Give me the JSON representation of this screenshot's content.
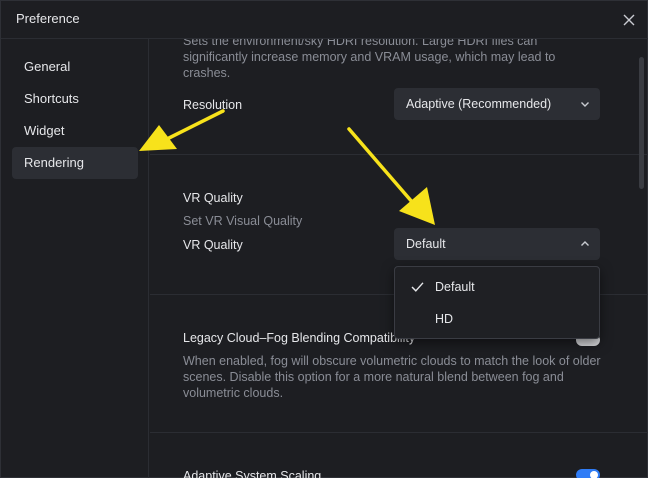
{
  "window": {
    "title": "Preference"
  },
  "sidebar": {
    "items": [
      {
        "label": "General"
      },
      {
        "label": "Shortcuts"
      },
      {
        "label": "Widget"
      },
      {
        "label": "Rendering"
      }
    ],
    "active": "Rendering"
  },
  "hdri": {
    "description": "Sets the environment/sky HDRI resolution. Large HDRI files can significantly increase memory and VRAM usage, which may lead to crashes.",
    "resolution_label": "Resolution",
    "resolution_value": "Adaptive (Recommended)"
  },
  "vr": {
    "heading": "VR Quality",
    "subheading": "Set VR Visual Quality",
    "quality_label": "VR Quality",
    "quality_value": "Default",
    "options": [
      {
        "label": "Default",
        "selected": true
      },
      {
        "label": "HD",
        "selected": false
      }
    ]
  },
  "legacy_fog": {
    "label": "Legacy Cloud–Fog Blending Compatibility",
    "description": "When enabled, fog will obscure volumetric clouds to match the look of older scenes. Disable this option for a more natural blend between fog and volumetric clouds."
  },
  "adaptive_scaling": {
    "label": "Adaptive System Scaling",
    "enabled": true
  },
  "colors": {
    "accent": "#2f7cf6",
    "annotation_arrow": "#f7e21b",
    "background": "#1d1e22"
  }
}
